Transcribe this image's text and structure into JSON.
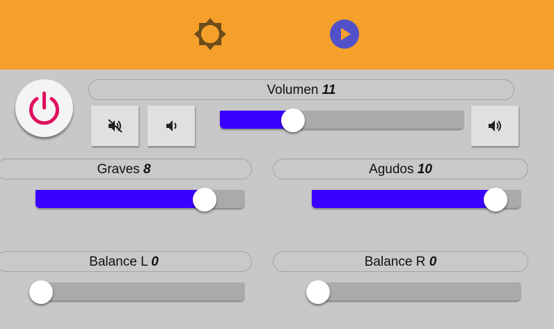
{
  "colors": {
    "topbar": "#f5a02a",
    "background": "#c8c8c8",
    "slider_fill": "#3a00ff",
    "slider_track": "#aaaaaa",
    "power_icon": "#e0105f",
    "play_button": "#5050c8",
    "brightness_icon": "#6b4c1a"
  },
  "topbar": {
    "brightness_icon": "brightness-icon",
    "play_icon": "play-icon"
  },
  "power": {
    "icon": "power-icon"
  },
  "volume": {
    "label": "Volumen",
    "value": "11",
    "level": 0.3,
    "mute_icon": "volume-mute-icon",
    "down_icon": "volume-down-icon",
    "up_icon": "volume-up-icon"
  },
  "bass": {
    "label": "Graves",
    "value": "8",
    "level": 0.81
  },
  "treble": {
    "label": "Agudos",
    "value": "10",
    "level": 0.88
  },
  "balance_left": {
    "label": "Balance L",
    "value": "0",
    "level": 0.02
  },
  "balance_right": {
    "label": "Balance R",
    "value": "0",
    "level": 0.03
  }
}
